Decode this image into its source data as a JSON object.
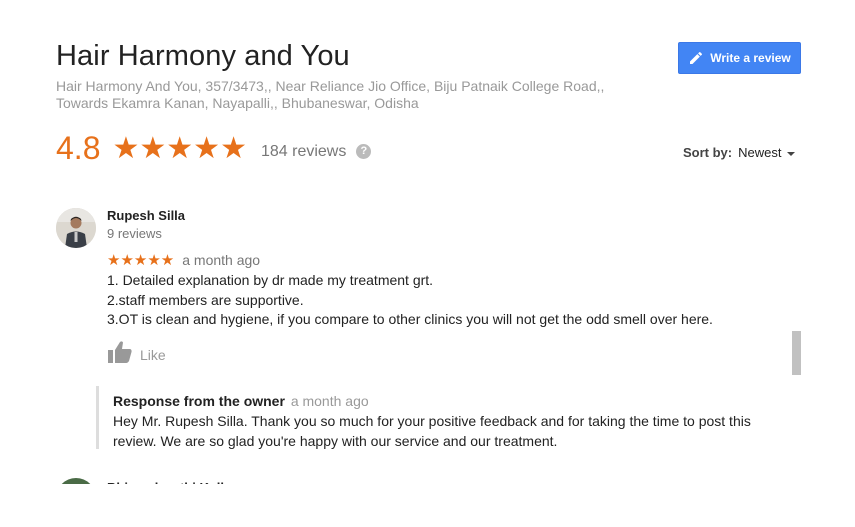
{
  "place": {
    "title": "Hair Harmony and You",
    "address": "Hair Harmony And You, 357/3473,, Near Reliance Jio Office, Biju Patnaik College Road,, Towards Ekamra Kanan, Nayapalli,, Bhubaneswar, Odisha"
  },
  "write_review": {
    "label": "Write a review",
    "icon": "pencil-icon",
    "color": "#4285f4"
  },
  "summary": {
    "rating": "4.8",
    "stars": "★★★★★",
    "review_count": "184 reviews",
    "help_glyph": "?",
    "star_color": "#e7711b"
  },
  "sort": {
    "label": "Sort by:",
    "value": "Newest"
  },
  "reviews": [
    {
      "name": "Rupesh Silla",
      "count": "9 reviews",
      "stars": "★★★★★",
      "time": "a month ago",
      "lines": [
        "1. Detailed explanation by dr made my treatment grt.",
        "2.staff members are supportive.",
        "3.OT is clean and hygiene, if you compare to other clinics you will not get the odd smell over here."
      ],
      "like_label": "Like",
      "response": {
        "owner": "Response from the owner",
        "time": "a month ago",
        "text": "Hey Mr. Rupesh Silla. Thank you so much for your positive feedback and for taking the time to post this review. We are so glad you're happy with our service and our treatment."
      }
    }
  ],
  "next_review": {
    "name": "Bhigvedavathi Kolla"
  }
}
